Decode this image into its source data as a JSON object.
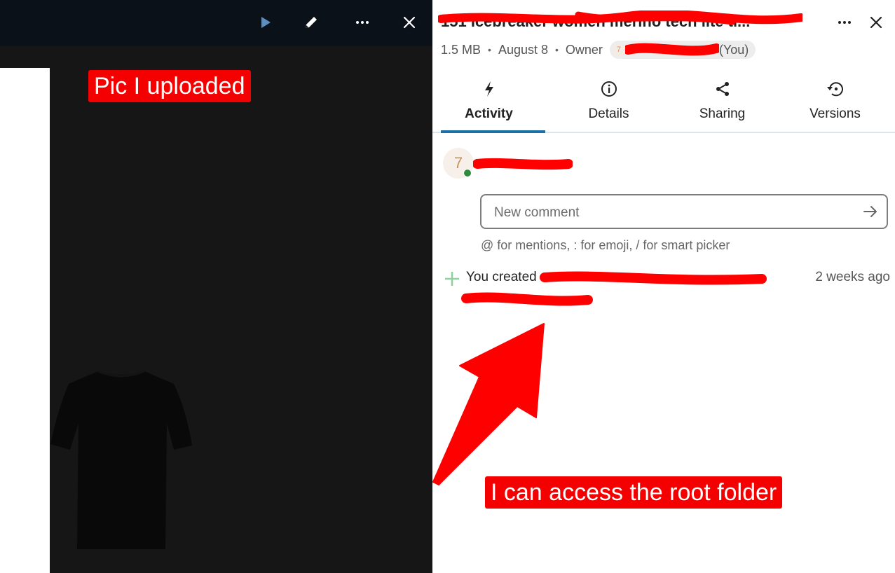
{
  "viewer": {
    "toolbar": {
      "play_icon": "play-icon",
      "edit_icon": "pencil-icon",
      "more_icon": "more-horizontal-icon",
      "close_icon": "close-icon"
    },
    "image_subject": "black t-shirt"
  },
  "sidebar": {
    "title": "151 Icebreaker women merino tech lite ti...",
    "meta": {
      "size": "1.5 MB",
      "date": "August 8",
      "owner_label": "Owner",
      "owner_avatar_initial": "7",
      "owner_you": "(You)"
    },
    "tabs": [
      {
        "label": "Activity",
        "icon": "lightning-icon",
        "active": true
      },
      {
        "label": "Details",
        "icon": "info-icon",
        "active": false
      },
      {
        "label": "Sharing",
        "icon": "share-icon",
        "active": false
      },
      {
        "label": "Versions",
        "icon": "history-icon",
        "active": false
      }
    ],
    "user_avatar_initial": "7",
    "comment": {
      "placeholder": "New comment",
      "hint": "@ for mentions, : for emoji, / for smart picker"
    },
    "activity": {
      "text": "You created",
      "time": "2 weeks ago"
    }
  },
  "annotations": {
    "uploaded_label": "Pic I uploaded",
    "root_label": "I can access the root folder"
  },
  "colors": {
    "accent": "#1b6fa8",
    "annotation_red": "#f40000",
    "viewer_bg": "#161616",
    "online_green": "#2f8a3e"
  }
}
